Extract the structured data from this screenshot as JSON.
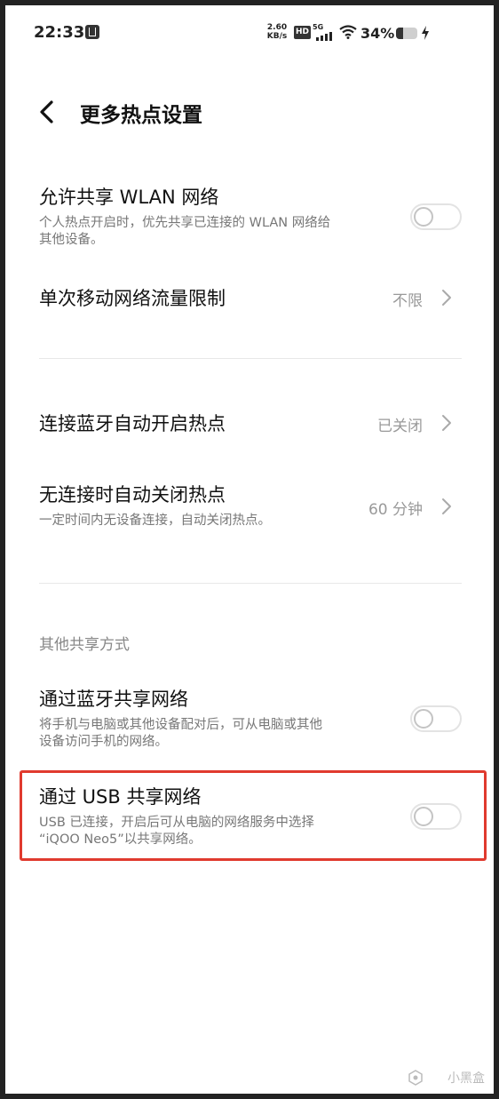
{
  "status_bar": {
    "time": "22:33",
    "speed_value": "2.60",
    "speed_unit": "KB/s",
    "hd_badge": "HD",
    "network_type": "5G",
    "battery_percent": "34%",
    "battery_level": 0.34
  },
  "header": {
    "title": "更多热点设置"
  },
  "settings": {
    "share_wlan": {
      "title": "允许共享 WLAN 网络",
      "desc_line1": "个人热点开启时，优先共享已连接的 WLAN 网络给",
      "desc_line2": "其他设备。",
      "enabled": false
    },
    "data_limit": {
      "title": "单次移动网络流量限制",
      "value": "不限"
    },
    "bluetooth_auto": {
      "title": "连接蓝牙自动开启热点",
      "value": "已关闭"
    },
    "auto_close": {
      "title": "无连接时自动关闭热点",
      "desc": "一定时间内无设备连接，自动关闭热点。",
      "value": "60 分钟"
    }
  },
  "other_sharing": {
    "section_label": "其他共享方式",
    "bluetooth_tether": {
      "title": "通过蓝牙共享网络",
      "desc_line1": "将手机与电脑或其他设备配对后，可从电脑或其他",
      "desc_line2": "设备访问手机的网络。",
      "enabled": false
    },
    "usb_tether": {
      "title": "通过 USB 共享网络",
      "desc_line1": "USB 已连接，开启后可从电脑的网络服务中选择",
      "desc_line2": "“iQOO Neo5”以共享网络。",
      "enabled": false
    }
  },
  "watermark": "小黑盒",
  "colors": {
    "highlight_border": "#e03a2e",
    "toggle_off": "#c4c4c4"
  }
}
